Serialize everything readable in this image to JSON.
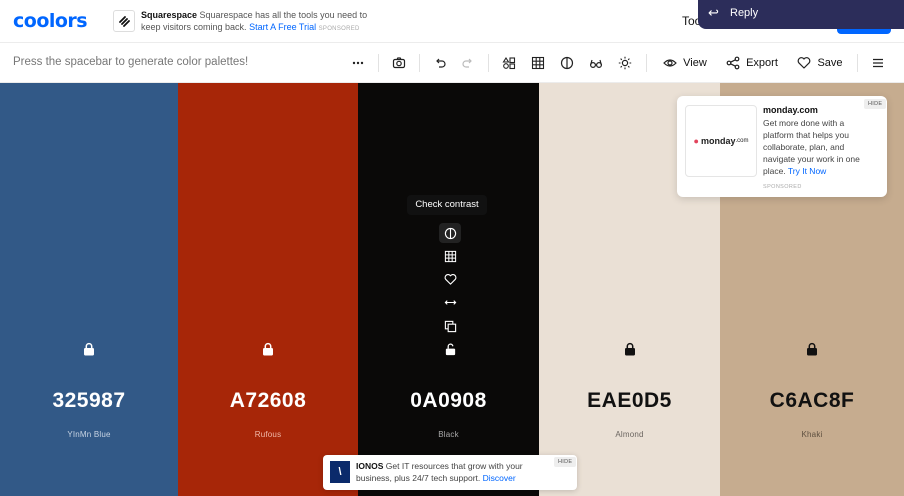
{
  "app": {
    "logo": "coolors"
  },
  "top_ad": {
    "brand": "Squarespace",
    "text": "Squarespace has all the tools you need to keep visitors coming back.",
    "cta": "Start A Free Trial",
    "sponsored": "SPONSORED"
  },
  "nav": {
    "tools_label_partial": "Too"
  },
  "reply_popup": {
    "label": "Reply"
  },
  "toolbar": {
    "hint": "Press the spacebar to generate color palettes!",
    "view_label": "View",
    "export_label": "Export",
    "save_label": "Save"
  },
  "palette": {
    "colors": [
      {
        "hex": "325987",
        "name": "YInMn Blue",
        "bg": "#325987",
        "fg": "#ffffff",
        "sub": "#c8d4e3"
      },
      {
        "hex": "A72608",
        "name": "Rufous",
        "bg": "#A72608",
        "fg": "#ffffff",
        "sub": "#f0b8a8"
      },
      {
        "hex": "0A0908",
        "name": "Black",
        "bg": "#0A0908",
        "fg": "#ffffff",
        "sub": "#a8a8a8"
      },
      {
        "hex": "EAE0D5",
        "name": "Almond",
        "bg": "#EAE0D5",
        "fg": "#111111",
        "sub": "#6b6560"
      },
      {
        "hex": "C6AC8F",
        "name": "Khaki",
        "bg": "#C6AC8F",
        "fg": "#111111",
        "sub": "#5e5040"
      }
    ]
  },
  "column_tools": {
    "tooltip": "Check contrast",
    "icons": [
      "contrast-icon",
      "shades-icon",
      "heart-icon",
      "drag-icon",
      "copy-icon",
      "lock-icon"
    ]
  },
  "side_ad": {
    "brand": "monday.com",
    "logo_text": "monday",
    "logo_suffix": ".com",
    "text": "Get more done with a platform that helps you collaborate, plan, and navigate your work in one place.",
    "cta": "Try It Now",
    "sponsored": "SPONSORED",
    "hide": "HIDE"
  },
  "bottom_ad": {
    "brand": "IONOS",
    "text": "Get IT resources that grow with your business, plus 24/7 tech support.",
    "cta": "Discover",
    "hide": "HIDE"
  }
}
